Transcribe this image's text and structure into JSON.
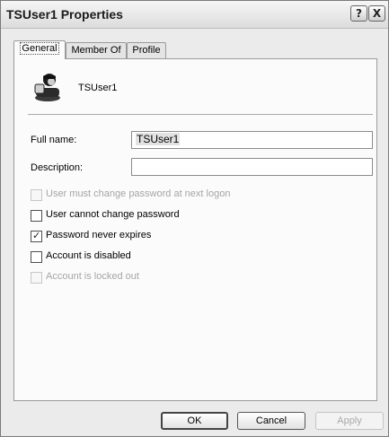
{
  "window": {
    "title": "TSUser1 Properties"
  },
  "titlebar": {
    "help_glyph": "?",
    "close_glyph": "X"
  },
  "tabs": [
    {
      "label": "General",
      "active": true
    },
    {
      "label": "Member Of",
      "active": false
    },
    {
      "label": "Profile",
      "active": false
    }
  ],
  "general": {
    "user_display_name": "TSUser1",
    "full_name_label": "Full name:",
    "full_name_value": "TSUser1",
    "description_label": "Description:",
    "description_value": ""
  },
  "checkboxes": [
    {
      "label": "User must change password at next logon",
      "checked": false,
      "enabled": false
    },
    {
      "label": "User cannot change password",
      "checked": false,
      "enabled": true
    },
    {
      "label": "Password never expires",
      "checked": true,
      "enabled": true
    },
    {
      "label": "Account is disabled",
      "checked": false,
      "enabled": true
    },
    {
      "label": "Account is locked out",
      "checked": false,
      "enabled": false
    }
  ],
  "buttons": {
    "ok": "OK",
    "cancel": "Cancel",
    "apply": "Apply"
  }
}
